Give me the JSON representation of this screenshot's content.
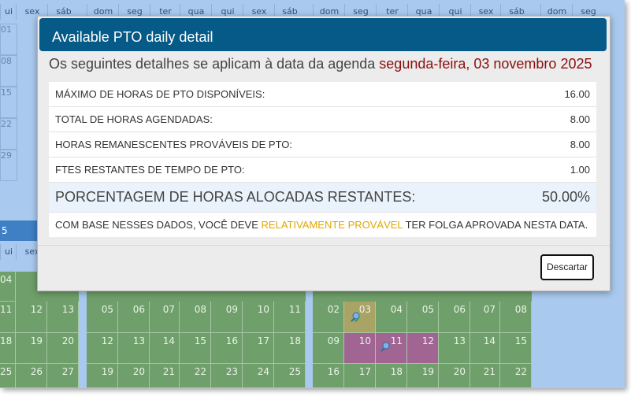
{
  "background": {
    "weekday_headers": [
      "ui",
      "sex",
      "sáb",
      "dom",
      "seg",
      "ter",
      "qua",
      "qui",
      "sex",
      "sáb",
      "dom",
      "seg",
      "ter",
      "qua",
      "qui",
      "sex",
      "sáb",
      "dom",
      "seg"
    ],
    "side_rows": [
      "01",
      "08",
      "15",
      "22",
      "29"
    ],
    "month_bar_fragment": "5",
    "weekday_headers_lower": [
      "ui",
      "sex"
    ],
    "calendar_rows": [
      [
        "04",
        "",
        "",
        "",
        "",
        "",
        "",
        "",
        "",
        "",
        "",
        "",
        "",
        "",
        "",
        "",
        "",
        ""
      ],
      [
        "11",
        "12",
        "13",
        "05",
        "06",
        "07",
        "08",
        "09",
        "10",
        "11",
        "02",
        "03",
        "04",
        "05",
        "06",
        "07",
        "08"
      ],
      [
        "18",
        "19",
        "20",
        "12",
        "13",
        "14",
        "15",
        "16",
        "17",
        "18",
        "09",
        "10",
        "11",
        "12",
        "13",
        "14",
        "15"
      ],
      [
        "25",
        "26",
        "27",
        "19",
        "20",
        "21",
        "22",
        "23",
        "24",
        "25",
        "16",
        "17",
        "18",
        "19",
        "20",
        "21",
        "22"
      ]
    ]
  },
  "modal": {
    "title": "Available PTO daily detail",
    "subtitle_prefix": "Os seguintes detalhes se aplicam à data da agenda",
    "subtitle_date": "segunda-feira, 03 novembro 2025",
    "rows": [
      {
        "label": "MÁXIMO DE HORAS DE PTO DISPONÍVEIS:",
        "value": "16.00"
      },
      {
        "label": "TOTAL DE HORAS AGENDADAS:",
        "value": "8.00"
      },
      {
        "label": "HORAS REMANESCENTES PROVÁVEIS DE PTO:",
        "value": "8.00"
      },
      {
        "label": "FTES RESTANTES DE TEMPO DE PTO:",
        "value": "1.00"
      }
    ],
    "summary": {
      "label": "PORCENTAGEM DE HORAS ALOCADAS RESTANTES:",
      "value": "50.00%"
    },
    "note": {
      "prefix": "COM BASE NESSES DADOS, VOCÊ DEVE",
      "highlight": "RELATIVAMENTE PROVÁVEL",
      "suffix": "TER FOLGA APROVADA NESTA DATA."
    },
    "dismiss_label": "Descartar"
  },
  "colors": {
    "header": "#055a88",
    "date": "#8b0e0e",
    "highlight": "#e0a700",
    "calendar_green": "#6f9f6a",
    "calendar_purple": "#a06593"
  }
}
